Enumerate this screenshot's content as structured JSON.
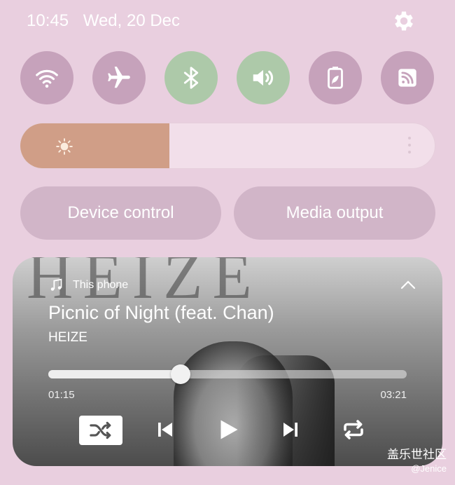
{
  "status_bar": {
    "time": "10:45",
    "date": "Wed, 20 Dec",
    "settings_icon": "gear-icon"
  },
  "quick_settings": [
    {
      "name": "wifi",
      "icon": "wifi-icon",
      "state": "off"
    },
    {
      "name": "airplane-mode",
      "icon": "airplane-icon",
      "state": "off"
    },
    {
      "name": "bluetooth",
      "icon": "bluetooth-icon",
      "state": "on"
    },
    {
      "name": "sound",
      "icon": "volume-icon",
      "state": "on"
    },
    {
      "name": "power-saving",
      "icon": "battery-leaf-icon",
      "state": "off"
    },
    {
      "name": "cast",
      "icon": "cast-icon",
      "state": "off"
    }
  ],
  "brightness": {
    "level_fraction": 0.36,
    "icon": "sun-icon"
  },
  "buttons": {
    "device_control": "Device control",
    "media_output": "Media output"
  },
  "media": {
    "source": "This phone",
    "title": "Picnic of Night (feat. Chan)",
    "artist": "HEIZE",
    "elapsed": "01:15",
    "duration": "03:21",
    "progress_fraction": 0.37,
    "controls": [
      "shuffle-icon",
      "previous-icon",
      "play-icon",
      "next-icon",
      "repeat-icon"
    ]
  },
  "watermark": {
    "line1": "盖乐世社区",
    "line2": "@Jenice"
  },
  "colors": {
    "background": "#e9cfdf",
    "tile_off": "#c6a2bb",
    "tile_on": "#adc9a9",
    "brightness_fill": "#d09e87"
  }
}
